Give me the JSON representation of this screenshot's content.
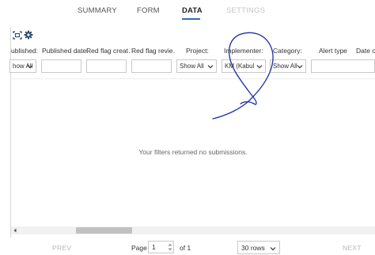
{
  "tabs": [
    {
      "label": "SUMMARY",
      "state": "normal"
    },
    {
      "label": "FORM",
      "state": "normal"
    },
    {
      "label": "DATA",
      "state": "active"
    },
    {
      "label": "SETTINGS",
      "state": "disabled"
    }
  ],
  "toolbar": {
    "icons": [
      "expand-icon",
      "gear-icon"
    ]
  },
  "columns": [
    {
      "label": "ublished:"
    },
    {
      "label": "Published date:"
    },
    {
      "label": "Red flag creat…"
    },
    {
      "label": "Red flag revie…"
    },
    {
      "label": "Project:"
    },
    {
      "label": "Implementer:"
    },
    {
      "label": "Category:"
    },
    {
      "label": "Alert type"
    },
    {
      "label": "Date of"
    }
  ],
  "filters": {
    "published": "how All",
    "published_date": "",
    "red_flag_created": "",
    "red_flag_reviewed": "",
    "project": "Show All",
    "implementer": "KM (Kabul",
    "category": "Show All",
    "alert_type": ""
  },
  "empty_message": "Your filters returned no submissions.",
  "pagination": {
    "prev_label": "PREV",
    "next_label": "NEXT",
    "page_label": "Page",
    "page_value": "1",
    "of_label": "of 1",
    "rows_selected": "30 rows"
  },
  "colors": {
    "accent": "#2a6fb0",
    "annotation_ink": "#1d2fa8"
  }
}
